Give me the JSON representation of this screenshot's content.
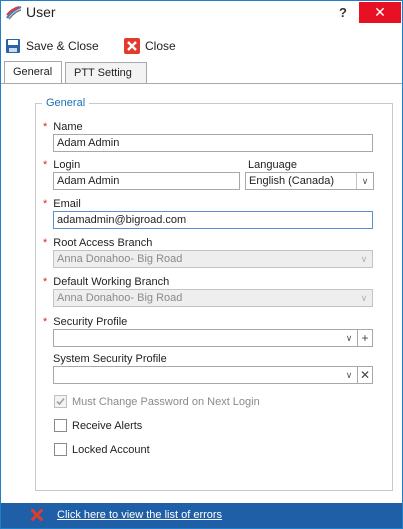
{
  "window": {
    "title": "User",
    "help": "?",
    "close": "✕"
  },
  "toolbar": {
    "save_close_label": "Save & Close",
    "close_label": "Close"
  },
  "tabs": [
    {
      "label": "General",
      "active": true
    },
    {
      "label": "PTT Setting",
      "active": false
    }
  ],
  "general": {
    "legend": "General",
    "name": {
      "label": "Name",
      "value": "Adam Admin",
      "required": true
    },
    "login": {
      "label": "Login",
      "value": "Adam Admin",
      "required": true
    },
    "language": {
      "label": "Language",
      "value": "English (Canada)"
    },
    "email": {
      "label": "Email",
      "value": "adamadmin@bigroad.com",
      "required": true
    },
    "root_access_branch": {
      "label": "Root Access Branch",
      "value": "Anna Donahoo- Big Road",
      "required": true,
      "disabled": true
    },
    "default_working_branch": {
      "label": "Default Working Branch",
      "value": "Anna Donahoo- Big Road",
      "required": true,
      "disabled": true
    },
    "security_profile": {
      "label": "Security Profile",
      "value": "",
      "required": true
    },
    "system_security_profile": {
      "label": "System Security Profile",
      "value": ""
    },
    "must_change_password": {
      "label": "Must Change Password on Next Login",
      "checked": true,
      "disabled": true
    },
    "receive_alerts": {
      "label": "Receive Alerts",
      "checked": false
    },
    "locked_account": {
      "label": "Locked Account",
      "checked": false
    }
  },
  "status": {
    "errors_link": "Click here to view the list of errors"
  },
  "colors": {
    "accent": "#1f5fa8",
    "required": "#d9262c",
    "close_button": "#e81123"
  }
}
